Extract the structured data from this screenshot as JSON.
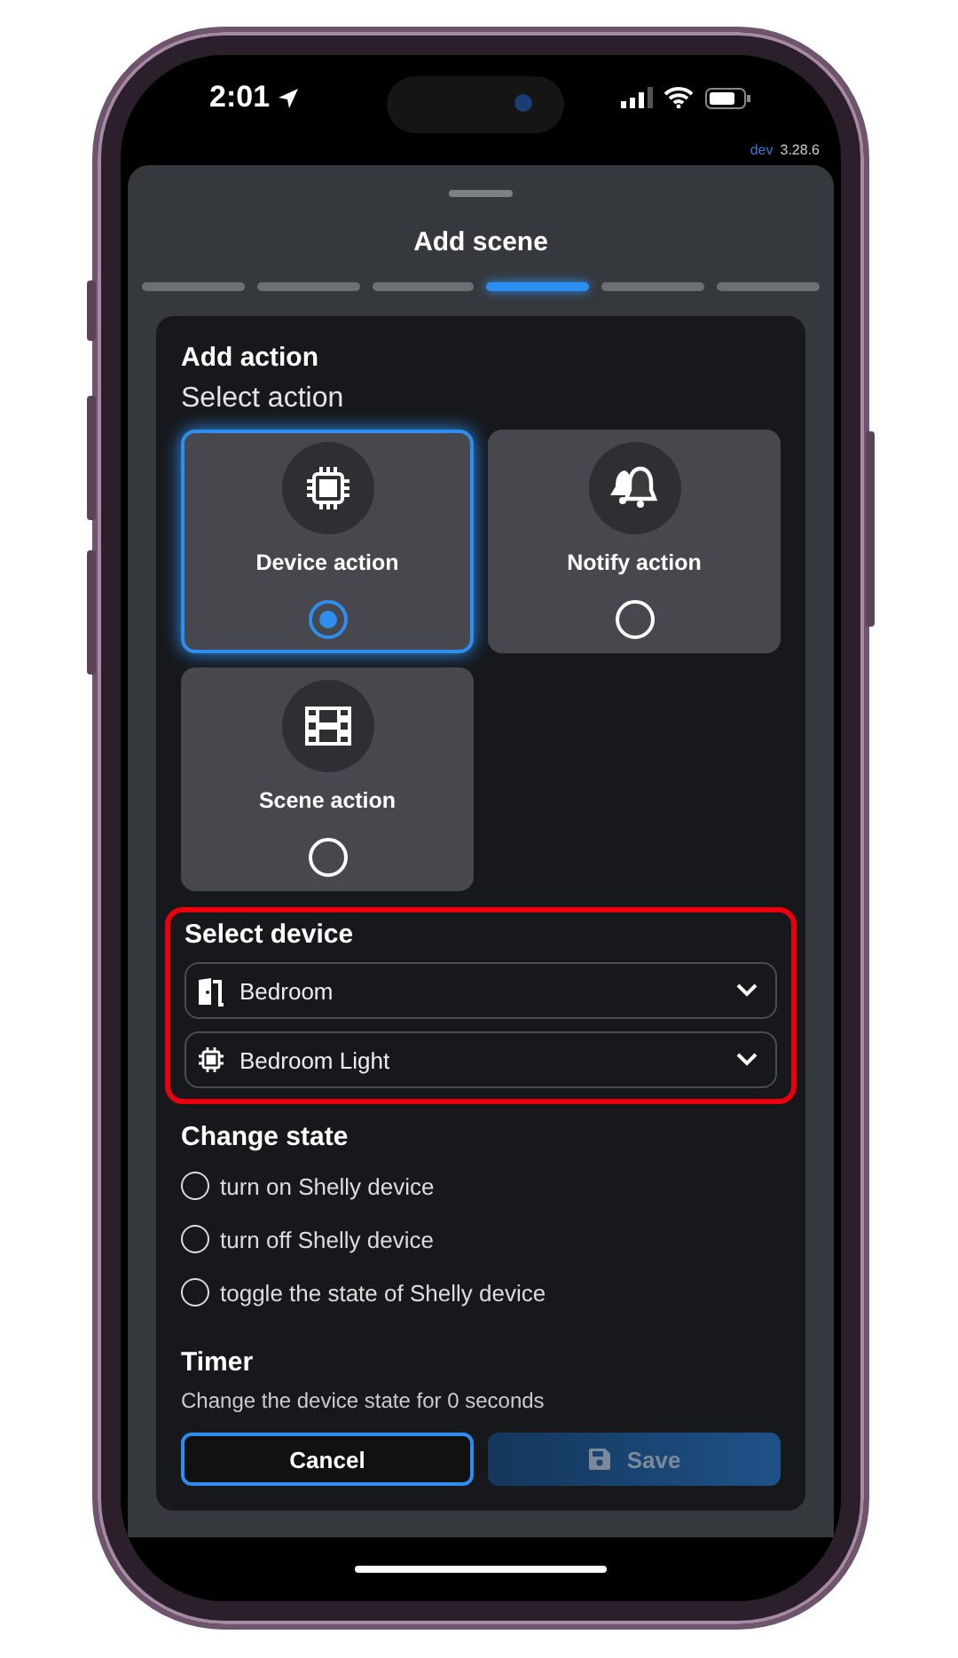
{
  "status_bar": {
    "time": "2:01"
  },
  "build": {
    "channel": "dev",
    "version": "3.28.6"
  },
  "sheet": {
    "title": "Add scene",
    "steps": [
      {
        "selected": false
      },
      {
        "selected": false
      },
      {
        "selected": false
      },
      {
        "selected": true
      },
      {
        "selected": false
      },
      {
        "selected": false
      }
    ],
    "heading": "Add action",
    "subheading": "Select action",
    "actions": [
      {
        "kind": "device",
        "label": "Device action",
        "selected": true
      },
      {
        "kind": "notify",
        "label": "Notify action",
        "selected": false
      },
      {
        "kind": "scene",
        "label": "Scene action",
        "selected": false
      }
    ],
    "device_section": {
      "title": "Select device",
      "highlighted": true,
      "dropdowns": [
        {
          "kind": "room",
          "value": "Bedroom"
        },
        {
          "kind": "device",
          "value": "Bedroom Light"
        }
      ]
    },
    "state_section": {
      "title": "Change state",
      "options": [
        {
          "label": "turn on Shelly device",
          "selected": false
        },
        {
          "label": "turn off Shelly device",
          "selected": false
        },
        {
          "label": "toggle the state of Shelly device",
          "selected": false
        }
      ]
    },
    "timer": {
      "title": "Timer",
      "text": "Change the device state for 0 seconds"
    },
    "buttons": [
      {
        "kind": "secondary",
        "label": "Cancel",
        "disabled": false
      },
      {
        "kind": "primary",
        "label": "Save",
        "disabled": true
      }
    ]
  }
}
